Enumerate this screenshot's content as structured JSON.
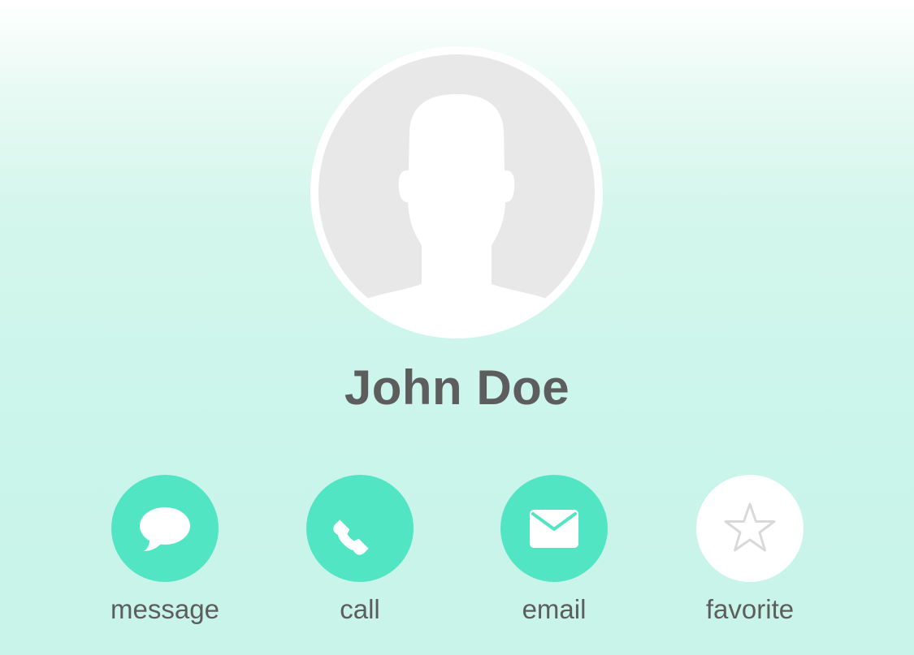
{
  "contact": {
    "name": "John Doe",
    "avatar_icon": "person-silhouette-icon"
  },
  "actions": [
    {
      "label": "message",
      "icon": "speech-bubble-icon",
      "active": true
    },
    {
      "label": "call",
      "icon": "phone-icon",
      "active": true
    },
    {
      "label": "email",
      "icon": "envelope-icon",
      "active": true
    },
    {
      "label": "favorite",
      "icon": "star-icon",
      "active": false
    }
  ],
  "colors": {
    "accent": "#52e5c4",
    "text": "#5d5d5d",
    "avatar_bg": "#e8e8e8",
    "inactive_button": "#ffffff",
    "inactive_icon": "#d9d9d9",
    "background_top": "#ffffff",
    "background_bottom": "#c8f4e9"
  }
}
